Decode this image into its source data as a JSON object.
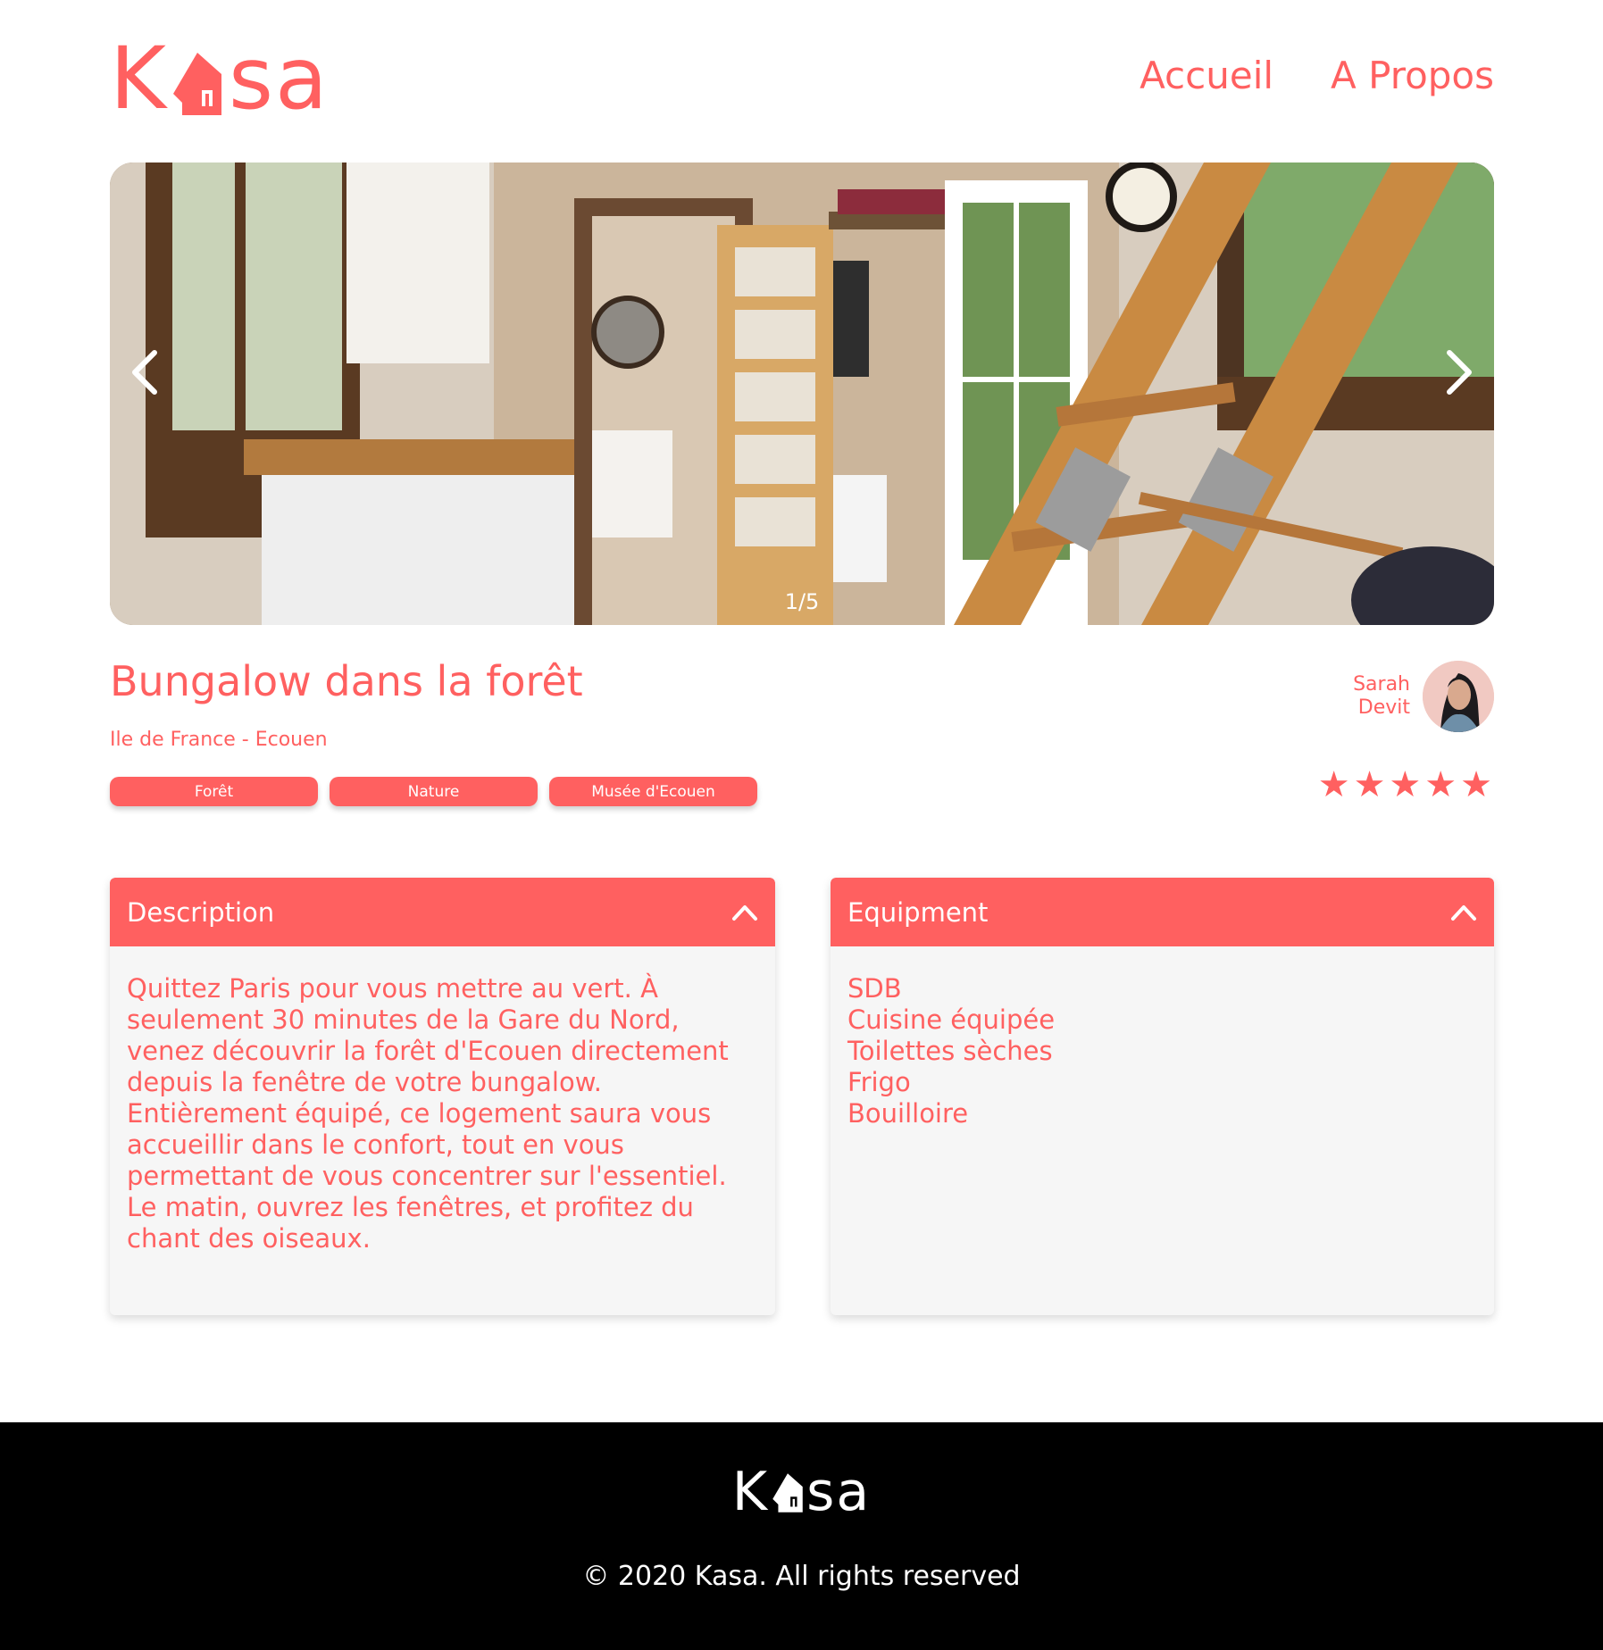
{
  "brand": {
    "logo_left": "K",
    "logo_right": "sa",
    "accent_color": "#FF6060"
  },
  "nav": {
    "items": [
      "Accueil",
      "A Propos"
    ]
  },
  "carousel": {
    "counter": "1/5",
    "prev_icon": "chevron-left-icon",
    "next_icon": "chevron-right-icon"
  },
  "listing": {
    "title": "Bungalow dans la forêt",
    "location": "Ile de France - Ecouen",
    "tags": [
      "Forêt",
      "Nature",
      "Musée d'Ecouen"
    ],
    "host": {
      "first_name": "Sarah",
      "last_name": "Devit"
    },
    "rating": 5,
    "rating_max": 5
  },
  "description": {
    "title": "Description",
    "text": "Quittez Paris pour vous mettre au vert. À seulement 30 minutes de la Gare du Nord, venez découvrir la forêt d'Ecouen directement depuis la fenêtre de votre bungalow. Entièrement équipé, ce logement saura vous accueillir dans le confort, tout en vous permettant de vous concentrer sur l'essentiel. Le matin, ouvrez les fenêtres, et profitez du chant des oiseaux."
  },
  "equipment": {
    "title": "Equipment",
    "items": [
      "SDB",
      "Cuisine équipée",
      "Toilettes sèches",
      "Frigo",
      "Bouilloire"
    ]
  },
  "footer": {
    "logo_left": "K",
    "logo_right": "sa",
    "copyright": "© 2020 Kasa. All rights reserved"
  }
}
